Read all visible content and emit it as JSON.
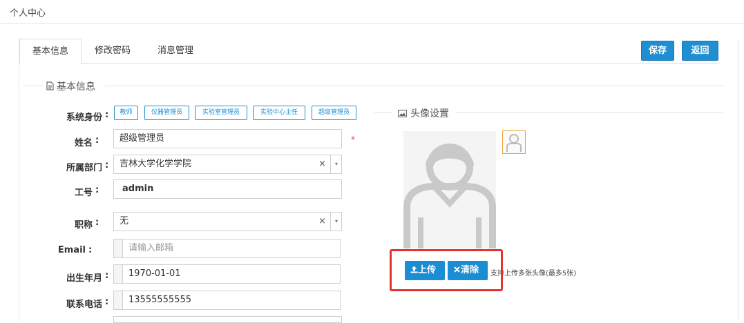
{
  "header": {
    "title": "个人中心"
  },
  "tabs": [
    {
      "label": "基本信息"
    },
    {
      "label": "修改密码"
    },
    {
      "label": "消息管理"
    }
  ],
  "actions": {
    "save": "保存",
    "back": "返回"
  },
  "basic_section": {
    "title": "基本信息"
  },
  "avatar_section": {
    "title": "头像设置"
  },
  "form": {
    "role": {
      "label": "系统身份",
      "options": [
        "教师",
        "仪器管理员",
        "实验室管理员",
        "实验中心主任",
        "超级管理员"
      ]
    },
    "name": {
      "label": "姓名",
      "value": "超级管理员"
    },
    "department": {
      "label": "所属部门",
      "value": "吉林大学化学学院"
    },
    "job_no": {
      "label": "工号",
      "value": "admin"
    },
    "title": {
      "label": "职称",
      "value": "无"
    },
    "email": {
      "label": "Email",
      "placeholder": "请输入邮箱"
    },
    "birth": {
      "label": "出生年月",
      "value": "1970-01-01"
    },
    "phone": {
      "label": "联系电话",
      "value": "13555555555"
    },
    "colon": ":",
    "required_mark": "*",
    "clear_glyph": "×",
    "caret_glyph": "▾"
  },
  "avatar": {
    "upload_label": "上传",
    "clear_label": "清除",
    "hint": "支持上传多张头像(最多5张)"
  },
  "colors": {
    "accent": "#1f8fd1",
    "highlight": "#e53333",
    "thumb_border": "#f0a23a"
  },
  "icons": [
    "document-icon",
    "image-icon",
    "upload-icon",
    "close-icon",
    "avatar-icon",
    "chevron-down-icon"
  ]
}
